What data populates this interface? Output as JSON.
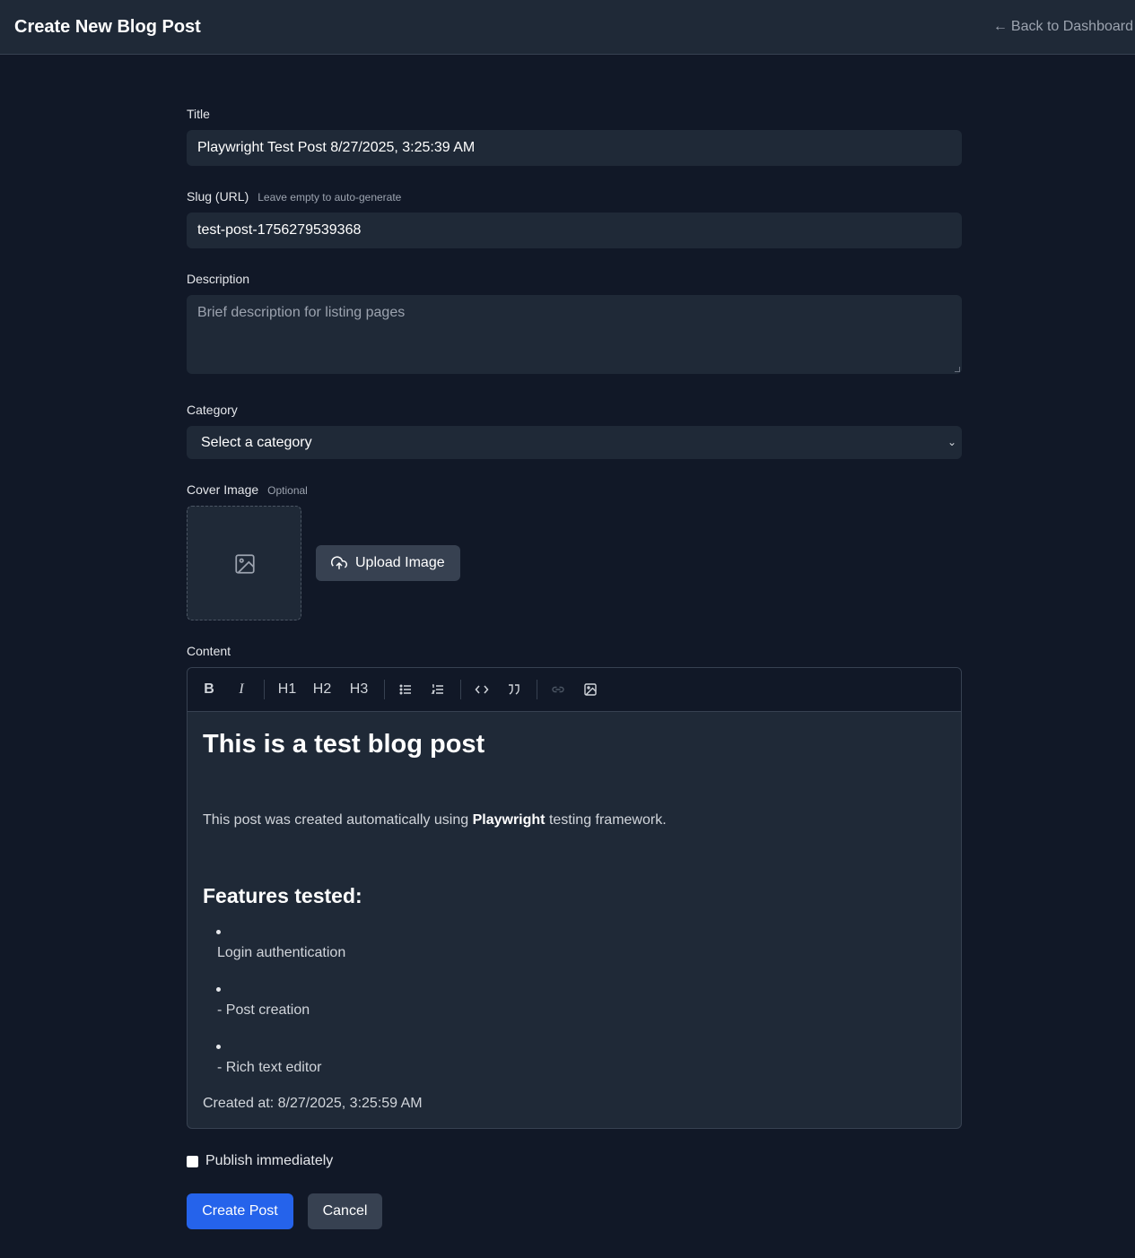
{
  "header": {
    "title": "Create New Blog Post",
    "back_label": "Back to Dashboard",
    "back_icon": "arrow-left-icon"
  },
  "form": {
    "title_label": "Title",
    "title_value": "Playwright Test Post 8/27/2025, 3:25:39 AM",
    "slug_label": "Slug (URL)",
    "slug_hint": "Leave empty to auto-generate",
    "slug_value": "test-post-1756279539368",
    "description_label": "Description",
    "description_value": "",
    "description_placeholder": "Brief description for listing pages",
    "category_label": "Category",
    "category_selected": "Select a category",
    "cover_label": "Cover Image",
    "cover_hint": "Optional",
    "upload_label": "Upload Image",
    "content_label": "Content",
    "publish_label": "Publish immediately",
    "publish_checked": false,
    "create_label": "Create Post",
    "cancel_label": "Cancel"
  },
  "toolbar": {
    "buttons": [
      {
        "name": "bold-icon",
        "label": "B"
      },
      {
        "name": "italic-icon",
        "label": "I"
      },
      {
        "name": "heading-1",
        "label": "H1"
      },
      {
        "name": "heading-2",
        "label": "H2"
      },
      {
        "name": "heading-3",
        "label": "H3"
      },
      {
        "name": "bullet-list-icon",
        "label": ""
      },
      {
        "name": "ordered-list-icon",
        "label": ""
      },
      {
        "name": "code-icon",
        "label": ""
      },
      {
        "name": "quote-icon",
        "label": ""
      },
      {
        "name": "link-icon",
        "label": ""
      },
      {
        "name": "image-icon",
        "label": ""
      }
    ]
  },
  "editor": {
    "heading": "This is a test blog post",
    "para_before": "This post was created automatically using ",
    "para_bold": "Playwright",
    "para_after": " testing framework.",
    "subheading": "Features tested:",
    "list_items": [
      "Login authentication",
      "- Post creation",
      "- Rich text editor"
    ],
    "created": "Created at: 8/27/2025, 3:25:59 AM"
  },
  "colors": {
    "background": "#111827",
    "surface": "#1f2937",
    "primary": "#2563eb",
    "secondary": "#374151"
  }
}
